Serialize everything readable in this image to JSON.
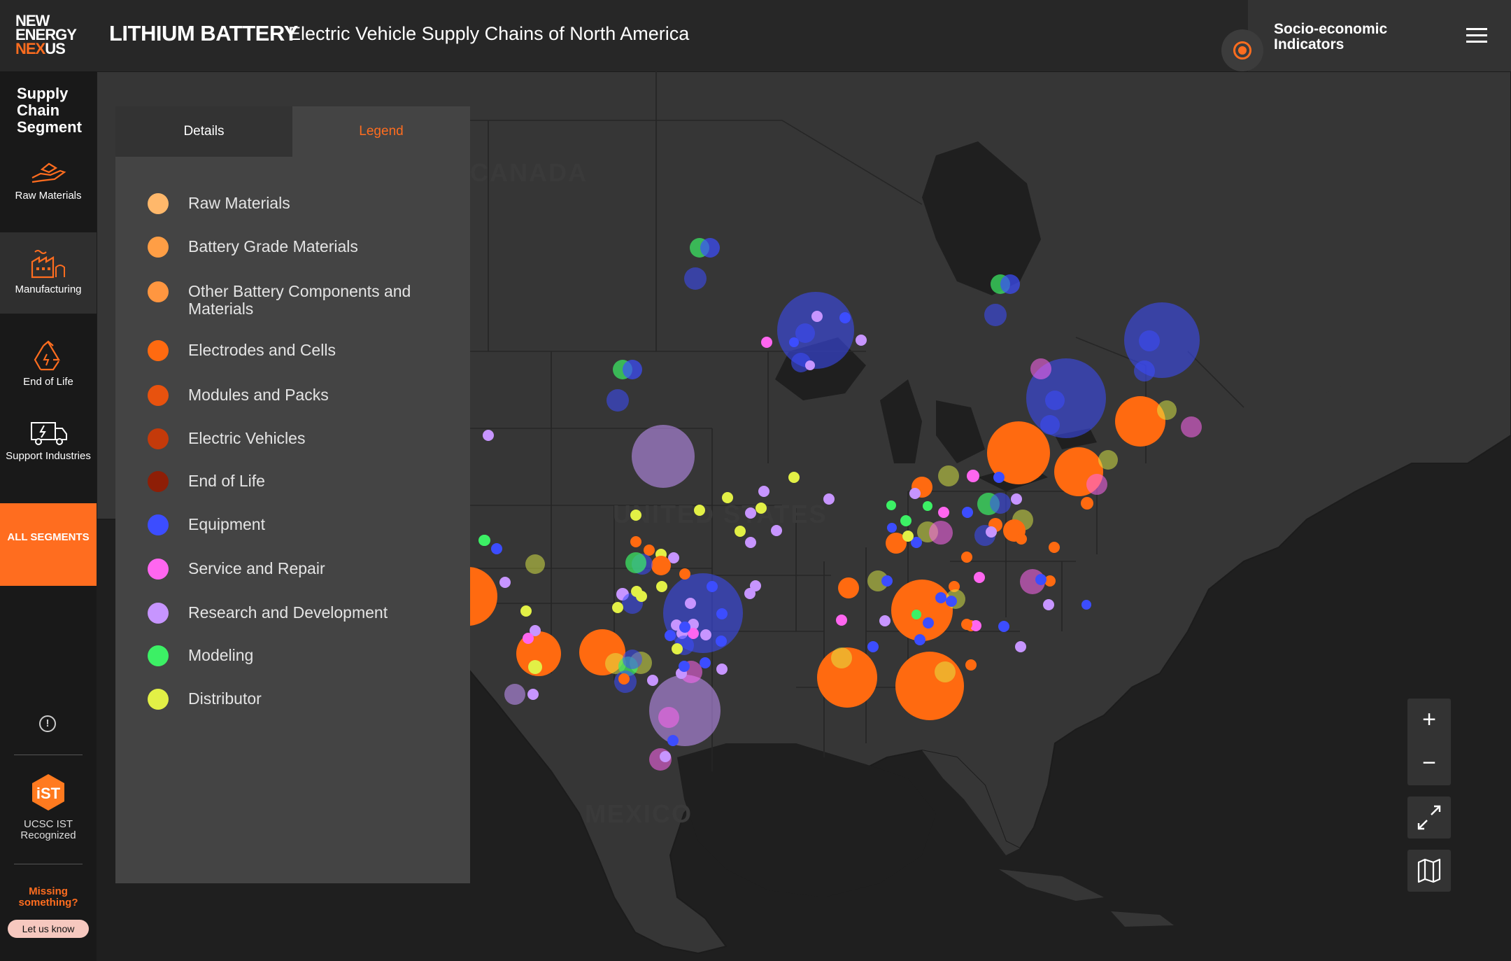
{
  "header": {
    "logo_line1": "NEW",
    "logo_line2": "ENERGY",
    "logo_line3_a": "NEX",
    "logo_line3_b": "US",
    "title": "LITHIUM BATTERY",
    "subtitle": "Electric Vehicle Supply Chains of North America",
    "socio_label": "Socio-economic Indicators",
    "menu_icon": "hamburger-menu-icon"
  },
  "sidebar": {
    "title": "Supply Chain Segment",
    "items": [
      {
        "label": "Raw Materials",
        "icon": "hand-material-icon"
      },
      {
        "label": "Manufacturing",
        "icon": "factory-icon"
      },
      {
        "label": "End of Life",
        "icon": "recycle-icon"
      },
      {
        "label": "Support Industries",
        "icon": "truck-battery-icon"
      }
    ],
    "all_segments": "ALL SEGMENTS",
    "ist_badge": "iST",
    "ist_text": "UCSC IST Recognized",
    "missing": "Missing something?",
    "let_us_know": "Let us know"
  },
  "panel": {
    "tab_details": "Details",
    "tab_legend": "Legend",
    "legend": [
      {
        "label": "Raw Materials",
        "color": "#ffb86b"
      },
      {
        "label": "Battery Grade Materials",
        "color": "#ff9e45"
      },
      {
        "label": "Other Battery Components and Materials",
        "color": "#ff9640"
      },
      {
        "label": "Electrodes and Cells",
        "color": "#ff6a10"
      },
      {
        "label": "Modules and Packs",
        "color": "#e8520e"
      },
      {
        "label": "Electric Vehicles",
        "color": "#c43a0a"
      },
      {
        "label": "End of Life",
        "color": "#8e1e06"
      },
      {
        "label": "Equipment",
        "color": "#3c4dff"
      },
      {
        "label": "Service and Repair",
        "color": "#ff66f0"
      },
      {
        "label": "Research and Development",
        "color": "#c795ff"
      },
      {
        "label": "Modeling",
        "color": "#3cf065"
      },
      {
        "label": "Distributor",
        "color": "#e2f046"
      }
    ]
  },
  "map": {
    "label_canada": "CANADA",
    "label_us": "UNITED STATES",
    "label_mexico": "MEXICO"
  },
  "controls": {
    "zoom_in": "+",
    "zoom_out": "−",
    "fullscreen_icon": "expand-icon",
    "basemap_icon": "map-icon"
  }
}
